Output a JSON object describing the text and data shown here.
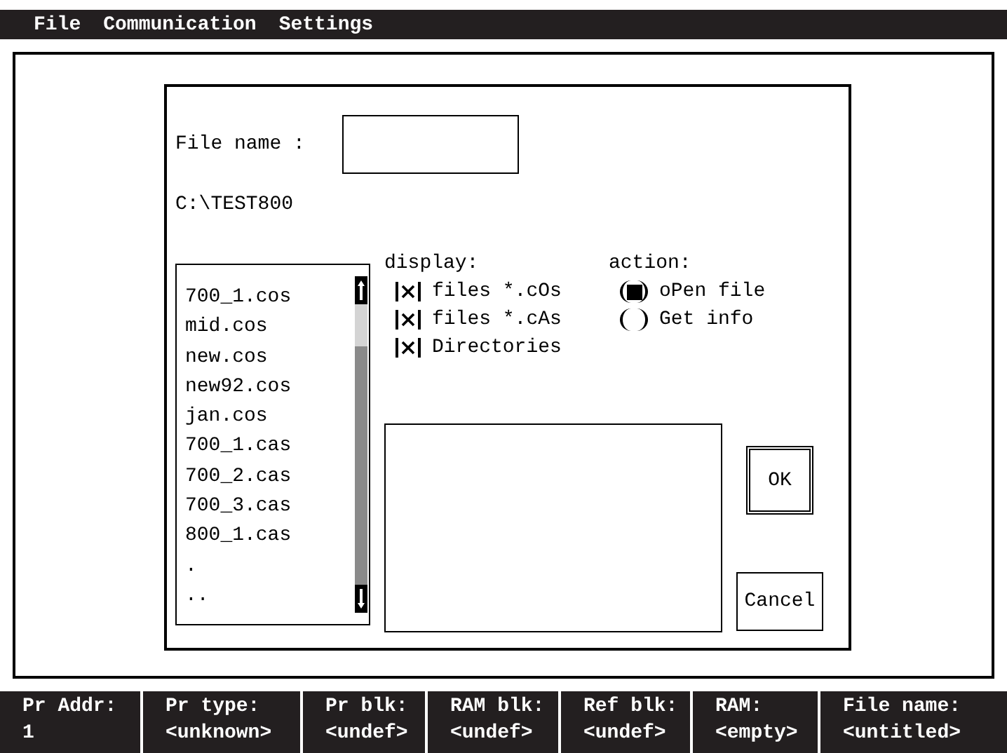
{
  "menu": [
    {
      "label": "File"
    },
    {
      "label": "Communication"
    },
    {
      "label": "Settings"
    }
  ],
  "dialog": {
    "file_name_label": "File name :",
    "path": "C:\\TEST800",
    "files": [
      "700_1.cos",
      "mid.cos",
      "new.cos",
      "new92.cos",
      "jan.cos",
      "700_1.cas",
      "700_2.cas",
      "700_3.cas",
      "800_1.cas",
      ".",
      ".."
    ],
    "display_label": "display:",
    "display_options": [
      {
        "label": "files *.cOs",
        "checked": true
      },
      {
        "label": "files *.cAs",
        "checked": true
      },
      {
        "label": "Directories",
        "checked": true
      }
    ],
    "action_label": "action:",
    "action_options": [
      {
        "label": "oPen file",
        "selected": true
      },
      {
        "label": "Get info",
        "selected": false
      }
    ],
    "buttons": [
      {
        "label": "OK",
        "kind": "default"
      },
      {
        "label": "Cancel",
        "kind": "normal"
      }
    ]
  },
  "status_bar": [
    {
      "label": "Pr Addr:",
      "value": "1"
    },
    {
      "label": "Pr type:",
      "value": "<unknown>"
    },
    {
      "label": "Pr blk:",
      "value": "<undef>"
    },
    {
      "label": "RAM blk:",
      "value": "<undef>"
    },
    {
      "label": "Ref blk:",
      "value": "<undef>"
    },
    {
      "label": "RAM:",
      "value": "<empty>"
    },
    {
      "label": "File name:",
      "value": "<untitled>"
    }
  ]
}
